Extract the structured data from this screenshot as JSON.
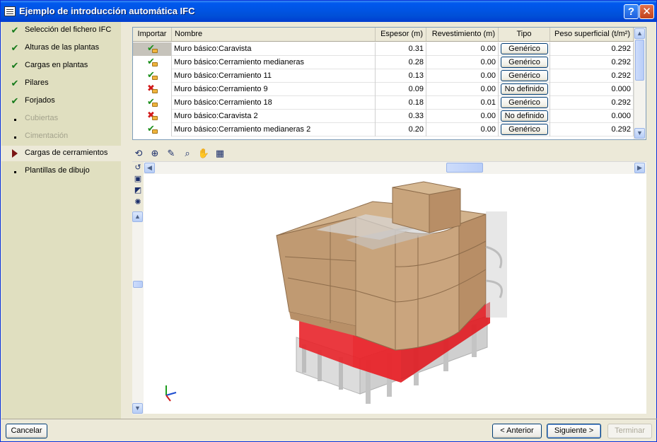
{
  "window": {
    "title": "Ejemplo de introducción automática IFC",
    "help_glyph": "?",
    "close_glyph": "✕"
  },
  "steps": [
    {
      "label": "Selección del fichero IFC",
      "state": "done"
    },
    {
      "label": "Alturas de las plantas",
      "state": "done"
    },
    {
      "label": "Cargas en plantas",
      "state": "done"
    },
    {
      "label": "Pilares",
      "state": "done"
    },
    {
      "label": "Forjados",
      "state": "done"
    },
    {
      "label": "Cubiertas",
      "state": "disabled"
    },
    {
      "label": "Cimentación",
      "state": "disabled"
    },
    {
      "label": "Cargas de cerramientos",
      "state": "current"
    },
    {
      "label": "Plantillas de dibujo",
      "state": "pending"
    }
  ],
  "table": {
    "columns": [
      "Importar",
      "Nombre",
      "Espesor (m)",
      "Revestimiento (m)",
      "Tipo",
      "Peso superficial (t/m²)"
    ],
    "rows": [
      {
        "status": "ok",
        "name": "Muro básico:Caravista",
        "espesor": "0.31",
        "revestimiento": "0.00",
        "tipo": "Genérico",
        "peso": "0.292"
      },
      {
        "status": "ok",
        "name": "Muro básico:Cerramiento medianeras",
        "espesor": "0.28",
        "revestimiento": "0.00",
        "tipo": "Genérico",
        "peso": "0.292"
      },
      {
        "status": "ok",
        "name": "Muro básico:Cerramiento 11",
        "espesor": "0.13",
        "revestimiento": "0.00",
        "tipo": "Genérico",
        "peso": "0.292"
      },
      {
        "status": "no",
        "name": "Muro básico:Cerramiento 9",
        "espesor": "0.09",
        "revestimiento": "0.00",
        "tipo": "No definido",
        "peso": "0.000"
      },
      {
        "status": "ok",
        "name": "Muro básico:Cerramiento 18",
        "espesor": "0.18",
        "revestimiento": "0.01",
        "tipo": "Genérico",
        "peso": "0.292"
      },
      {
        "status": "no",
        "name": "Muro básico:Caravista 2",
        "espesor": "0.33",
        "revestimiento": "0.00",
        "tipo": "No definido",
        "peso": "0.000"
      },
      {
        "status": "ok",
        "name": "Muro básico:Cerramiento medianeras 2",
        "espesor": "0.20",
        "revestimiento": "0.00",
        "tipo": "Genérico",
        "peso": "0.292"
      }
    ]
  },
  "viewer": {
    "toolbar": [
      "rotate-view-icon",
      "zoom-extents-icon",
      "edit-pen-icon",
      "zoom-window-icon",
      "pan-hand-icon",
      "floor-plan-icon"
    ],
    "side_tools": [
      "undo-view-icon",
      "front-view-icon",
      "section-view-icon",
      "display-options-icon"
    ]
  },
  "colors": {
    "brick": "#c09a72",
    "brick_dark": "#8e6d4c",
    "highlight_red": "#e8242a",
    "glass": "#cfcfcf"
  },
  "footer": {
    "cancel": "Cancelar",
    "previous": "< Anterior",
    "next": "Siguiente >",
    "finish": "Terminar"
  }
}
